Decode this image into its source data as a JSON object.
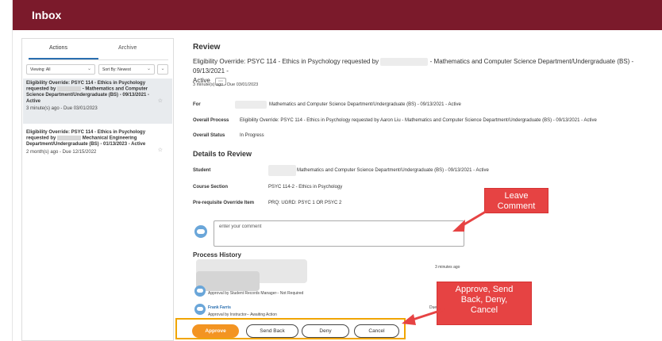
{
  "header": {
    "title": "Inbox"
  },
  "sidebar": {
    "tabs": {
      "actions": "Actions",
      "archive": "Archive"
    },
    "filters": {
      "viewing": "Viewing: All",
      "sort": "Sort By: Newest"
    },
    "items": [
      {
        "title_a": "Eligibility Override: PSYC 114 - Ethics in Psychology requested by",
        "title_b": "- Mathematics and Computer Science Department/Undergraduate (BS) - 09/13/2021 - Active",
        "meta": "3 minute(s) ago - Due 03/01/2023"
      },
      {
        "title_a": "Eligibility Override: PSYC 114 - Ethics in Psychology requested by",
        "title_b": "Mechanical Engineering Department/Undergraduate (BS) - 01/13/2023 - Active",
        "meta": "2 month(s) ago - Due 12/15/2022"
      }
    ]
  },
  "review": {
    "heading": "Review",
    "subtitle_a": "Eligibility Override: PSYC 114 - Ethics in Psychology requested by",
    "subtitle_b": "- Mathematics and Computer Science Department/Undergraduate (BS) - 09/13/2021 -",
    "subtitle_c": "Active",
    "more_button": "⋯",
    "due": "3 minute(s) ago - Due 03/01/2023",
    "for_label": "For",
    "for_value": "Mathematics and Computer Science Department/Undergraduate (BS) - 09/13/2021 - Active",
    "overall_process_label": "Overall Process",
    "overall_process_value": "Eligibility Override: PSYC 114 - Ethics in Psychology requested by Aaron Liu - Mathematics and Computer Science Department/Undergraduate (BS) - 09/13/2021 - Active",
    "overall_status_label": "Overall Status",
    "overall_status_value": "In Progress"
  },
  "details": {
    "heading": "Details to Review",
    "student_label": "Student",
    "student_value": "Mathematics and Computer Science Department/Undergraduate (BS) - 09/13/2021 - Active",
    "course_label": "Course Section",
    "course_value": "PSYC 114-2 - Ethics in Psychology",
    "prereq_label": "Pre-requisite Override Item",
    "prereq_value": "PRQ: UGRD: PSYC 1 OR PSYC 2"
  },
  "comment": {
    "placeholder": "enter your comment"
  },
  "process_history": {
    "heading": "Process History",
    "time": "3 minutes ago",
    "step1": "Approval by Student Records Manager-- Not Required",
    "step2_name": "Frank Farris",
    "step2_status": "Approval by Instructor-- Awaiting Action",
    "step2_due": "Due"
  },
  "actions": {
    "approve": "Approve",
    "send_back": "Send Back",
    "deny": "Deny",
    "cancel": "Cancel"
  },
  "callouts": {
    "leave_comment_1": "Leave",
    "leave_comment_2": "Comment",
    "approve_1": "Approve, Send",
    "approve_2": "Back, Deny,",
    "approve_3": "Cancel"
  },
  "colors": {
    "header_bg": "#7b1a2b",
    "approve_bg": "#f39422",
    "callout_bg": "#e64343",
    "action_bar_border": "#f0a500"
  }
}
